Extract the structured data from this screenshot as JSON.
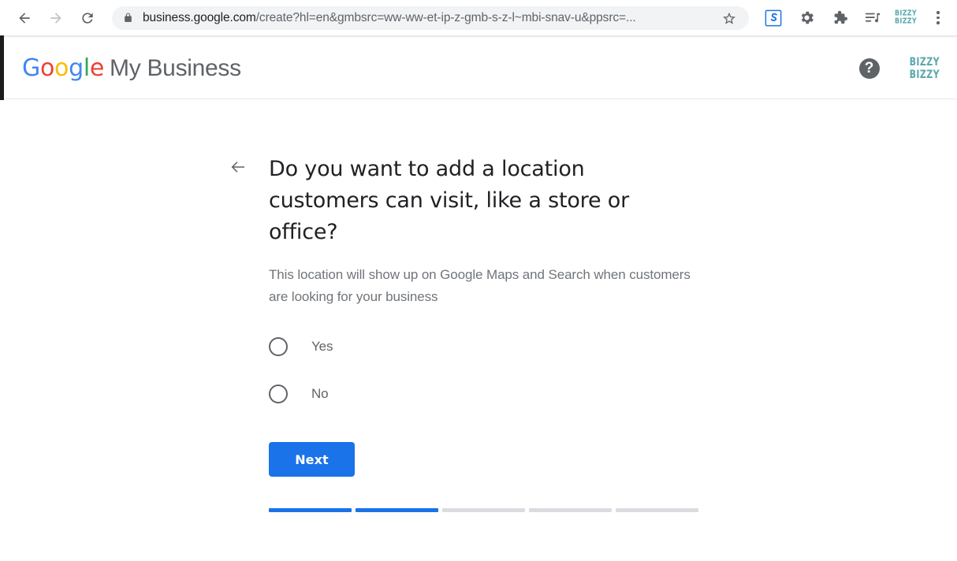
{
  "browser": {
    "back_icon": "back-arrow-icon",
    "forward_icon": "forward-arrow-icon",
    "reload_icon": "reload-icon",
    "lock_icon": "lock-icon",
    "url_host": "business.google.com",
    "url_path": "/create?hl=en&gmbsrc=ww-ww-et-ip-z-gmb-s-z-l~mbi-snav-u&ppsrc=...",
    "url_full": "business.google.com/create?hl=en&gmbsrc=ww-ww-et-ip-z-gmb-s-z-l~mbi-snav-u&ppsrc=...",
    "star_icon": "bookmark-star-icon",
    "extensions": [
      {
        "name": "scribe-extension-icon",
        "glyph": "S",
        "color": "#1a73e8"
      },
      {
        "name": "gear-extension-icon",
        "glyph": "gear",
        "color": "#5f6368"
      },
      {
        "name": "puzzle-extensions-icon",
        "glyph": "puzzle",
        "color": "#5f6368"
      },
      {
        "name": "playlist-extension-icon",
        "glyph": "playlist",
        "color": "#5f6368"
      },
      {
        "name": "bizzy-bizzy-extension-icon",
        "glyph": "BIZZY",
        "color": "#5aa8ad"
      }
    ],
    "menu_icon": "three-dot-menu-icon"
  },
  "header": {
    "brand_google": "Google",
    "brand_product": "My Business",
    "help_glyph": "?",
    "account_logo_line1": "BIZZY",
    "account_logo_line2": "BIZZY"
  },
  "main": {
    "back_icon": "back-arrow-icon",
    "headline": "Do you want to add a location customers can visit, like a store or office?",
    "subtext": "This location will show up on Google Maps and Search when customers are looking for your business",
    "options": [
      {
        "label": "Yes",
        "selected": false
      },
      {
        "label": "No",
        "selected": false
      }
    ],
    "next_label": "Next",
    "progress": {
      "total_steps": 5,
      "completed_steps": 2,
      "segments": [
        "done",
        "done",
        "todo",
        "todo",
        "todo"
      ]
    }
  },
  "colors": {
    "accent_blue": "#1a73e8",
    "text_primary": "#202124",
    "text_secondary": "#5f6368",
    "text_muted": "#70757a",
    "track_gray": "#dadce0",
    "brand_teal": "#5aa8ad",
    "google_blue": "#4285f4",
    "google_red": "#ea4335",
    "google_yellow": "#fbbc05",
    "google_green": "#34a853"
  }
}
